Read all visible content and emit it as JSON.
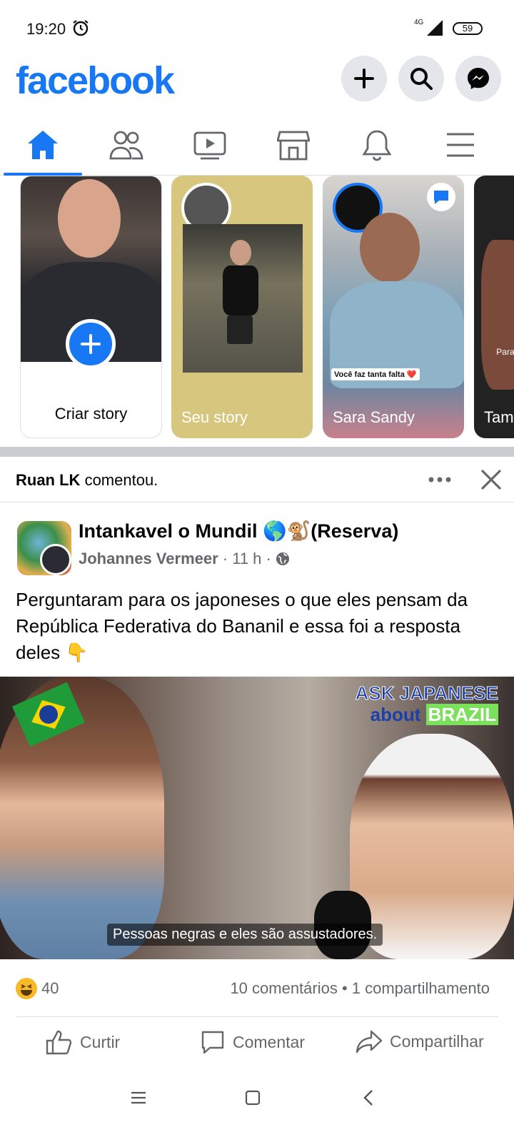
{
  "status_bar": {
    "time": "19:20",
    "network": "4G",
    "battery": "59"
  },
  "header": {
    "logo": "facebook",
    "buttons": [
      "create-icon",
      "search-icon",
      "messenger-icon"
    ]
  },
  "nav": {
    "tabs": [
      "home-icon",
      "friends-icon",
      "watch-icon",
      "marketplace-icon",
      "notifications-icon",
      "menu-icon"
    ],
    "active": "home"
  },
  "stories": {
    "create_label": "Criar story",
    "own_label": "Seu story",
    "friend_label": "Sara Sandy",
    "friend_caption": "Você faz tanta falta ❤️",
    "next_label": "Tam",
    "next_partial": "Parabé"
  },
  "activity": {
    "actor": "Ruan LK",
    "action": " comentou."
  },
  "post": {
    "group": "Intankavel o Mundil 🌎🐒(Reserva)",
    "author": "Johannes Vermeer",
    "time": " · 11 h · ",
    "text": "Perguntaram para os japoneses o que eles pensam da República Federativa do Bananil e essa foi a resposta deles 👇",
    "media": {
      "title_line1": "ASK JAPANESE",
      "title_line2_prefix": "about ",
      "title_line2_highlight": "BRAZIL",
      "subtitle": "Pessoas negras e eles são assustadores."
    },
    "reaction_count": "40",
    "stats": "10 comentários • 1 compartilhamento"
  },
  "actions": {
    "like": "Curtir",
    "comment": "Comentar",
    "share": "Compartilhar"
  },
  "colors": {
    "brand": "#1877f2",
    "secondary_text": "#65676b",
    "divider": "#c9ccd1"
  }
}
